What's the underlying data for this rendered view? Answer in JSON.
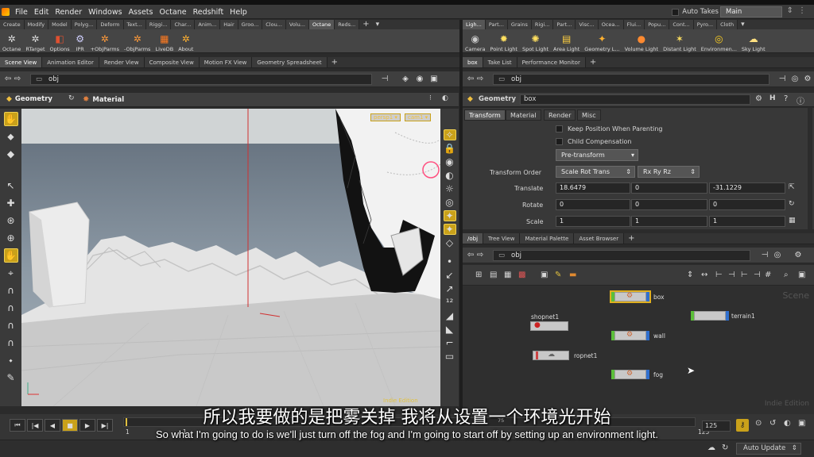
{
  "menubar": {
    "items": [
      "File",
      "Edit",
      "Render",
      "Windows",
      "Assets",
      "Octane",
      "Redshift",
      "Help"
    ],
    "auto_takes_label": "Auto Takes",
    "desktop": "Main"
  },
  "shelf_left": {
    "tabs": [
      "Create",
      "Modify",
      "Model",
      "Polyg...",
      "Deform",
      "Text...",
      "Riggi...",
      "Char...",
      "Anim...",
      "Hair",
      "Groo...",
      "Clou...",
      "Volu...",
      "Octane",
      "Reds..."
    ],
    "active_tab": "Octane",
    "tools": [
      "Octane",
      "RTarget",
      "Options",
      "IPR",
      "+ObjParms",
      "-ObjParms",
      "LiveDB",
      "About"
    ]
  },
  "shelf_right": {
    "tabs": [
      "Ligh...",
      "Part...",
      "Grains",
      "Rigi...",
      "Part...",
      "Visc...",
      "Ocea...",
      "Flui...",
      "Popu...",
      "Cont...",
      "Pyro...",
      "Cloth"
    ],
    "tools": [
      "Camera",
      "Point Light",
      "Spot Light",
      "Area Light",
      "Geometry L...",
      "Volume Light",
      "Distant Light",
      "Environmen...",
      "Sky Light"
    ]
  },
  "left_pane": {
    "tabs": [
      "Scene View",
      "Animation Editor",
      "Render View",
      "Composite View",
      "Motion FX View",
      "Geometry Spreadsheet"
    ],
    "path": "obj",
    "context_geometry": "Geometry",
    "context_material": "Material",
    "persp_label": "persp1",
    "cam_label": "cam1",
    "watermark": "Indie Edition"
  },
  "param_pane": {
    "tabs": [
      "box",
      "Take List",
      "Performance Monitor"
    ],
    "path": "obj",
    "node_type": "Geometry",
    "node_name": "box",
    "subtabs": [
      "Transform",
      "Material",
      "Render",
      "Misc"
    ],
    "keep_position": "Keep Position When Parenting",
    "child_comp": "Child Compensation",
    "pre_transform": "Pre-transform",
    "transform_order_label": "Transform Order",
    "transform_order_1": "Scale Rot Trans",
    "transform_order_2": "Rx Ry Rz",
    "translate_label": "Translate",
    "translate": [
      "18.6479",
      "0",
      "-31.1229"
    ],
    "rotate_label": "Rotate",
    "rotate": [
      "0",
      "0",
      "0"
    ],
    "scale_label": "Scale",
    "scale": [
      "1",
      "1",
      "1"
    ]
  },
  "network_pane": {
    "tabs": [
      "/obj",
      "Tree View",
      "Material Palette",
      "Asset Browser"
    ],
    "path": "obj",
    "corner_label": "Scene",
    "watermark": "Indie Edition",
    "nodes": [
      "box",
      "terrain1",
      "shopnet1",
      "wall",
      "ropnet1",
      "fog"
    ]
  },
  "timeline": {
    "start": "1",
    "current": "1",
    "tick_75": "75",
    "end": "125",
    "end_field": "125",
    "auto_update": "Auto Update"
  },
  "subtitles": {
    "zh": "所以我要做的是把雾关掉 我将从设置一个环境光开始",
    "en": "So what I'm going to do is we'll just turn off the fog and I'm going to start off by setting up an environment light."
  },
  "colors": {
    "accent_yellow": "#c9a11a",
    "node_green": "#5bbf3a",
    "node_blue": "#2f6fcf"
  }
}
